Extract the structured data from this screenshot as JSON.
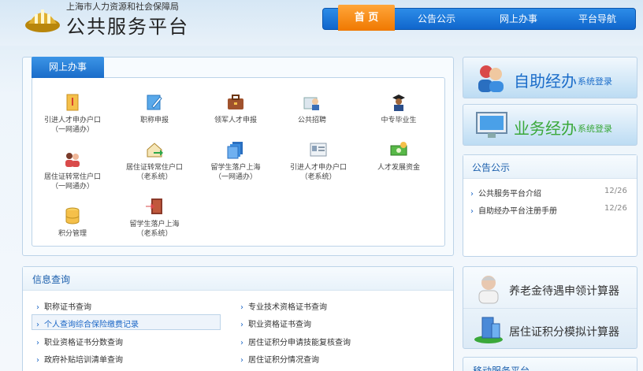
{
  "header": {
    "agency": "上海市人力资源和社会保障局",
    "title": "公共服务平台"
  },
  "nav": [
    {
      "label": "首 页"
    },
    {
      "label": "公告公示"
    },
    {
      "label": "网上办事"
    },
    {
      "label": "平台导航"
    }
  ],
  "online": {
    "tab": "网上办事",
    "items": [
      {
        "l1": "引进人才申办户口",
        "l2": "（一网通办）",
        "icon": "document-folder-icon"
      },
      {
        "l1": "职称申报",
        "l2": "",
        "icon": "edit-document-icon"
      },
      {
        "l1": "领军人才申报",
        "l2": "",
        "icon": "briefcase-icon"
      },
      {
        "l1": "公共招聘",
        "l2": "",
        "icon": "recruit-person-icon"
      },
      {
        "l1": "中专毕业生",
        "l2": "",
        "icon": "graduate-icon"
      },
      {
        "l1": "居住证转常住户口",
        "l2": "（一网通办）",
        "icon": "people-icon"
      },
      {
        "l1": "居住证转常住户口",
        "l2": "（老系统）",
        "icon": "house-arrow-icon"
      },
      {
        "l1": "留学生落户上海",
        "l2": "（一网通办）",
        "icon": "stacked-docs-icon"
      },
      {
        "l1": "引进人才申办户口",
        "l2": "（老系统）",
        "icon": "id-card-icon"
      },
      {
        "l1": "人才发展资金",
        "l2": "",
        "icon": "money-icon"
      },
      {
        "l1": "积分管理",
        "l2": "",
        "icon": "database-icon"
      },
      {
        "l1": "留学生落户上海",
        "l2": "（老系统）",
        "icon": "door-exit-icon"
      }
    ]
  },
  "login": {
    "self_main": "自助经办",
    "self_sub": "系统登录",
    "biz_main": "业务经办",
    "biz_sub": "系统登录"
  },
  "notice": {
    "title": "公告公示",
    "items": [
      {
        "text": "公共服务平台介绍",
        "date": "12/26"
      },
      {
        "text": "自助经办平台注册手册",
        "date": "12/26"
      }
    ]
  },
  "info": {
    "title": "信息查询",
    "left": [
      "职称证书查询",
      "个人查询综合保险缴费记录",
      "职业资格证书分数查询",
      "政府补贴培训清单查询"
    ],
    "right": [
      "专业技术资格证书查询",
      "职业资格证书查询",
      "居住证积分申请技能复核查询",
      "居住证积分情况查询"
    ]
  },
  "tools": {
    "pension": "养老金待遇申领计算器",
    "residence": "居住证积分模拟计算器",
    "mobile": "移动服务平台"
  },
  "colors": {
    "accent": "#1a6cc9",
    "active_tab": "#f07800"
  }
}
